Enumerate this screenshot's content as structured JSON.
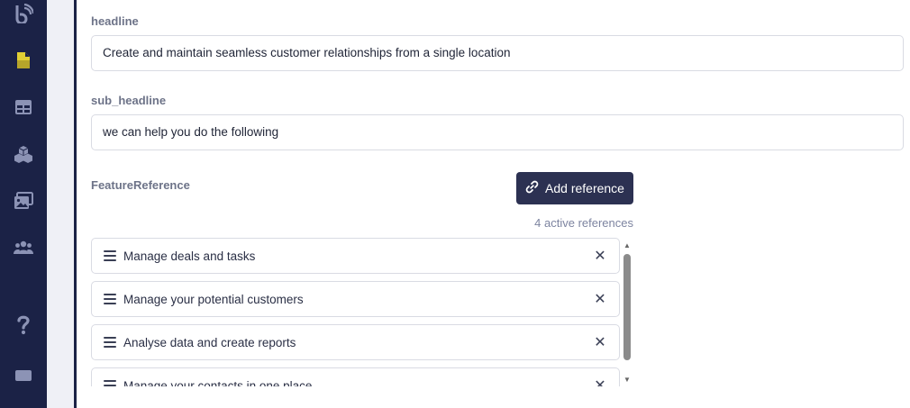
{
  "sidebar": {
    "icons": [
      "brand-logo-icon",
      "page-icon",
      "table-icon",
      "cubes-icon",
      "media-icon",
      "users-icon",
      "help-icon",
      "chat-icon"
    ],
    "active_color": "#e1cf34"
  },
  "fields": {
    "headline": {
      "label": "headline",
      "value": "Create and maintain seamless customer relationships from a single location"
    },
    "sub_headline": {
      "label": "sub_headline",
      "value": "we can help you do the following"
    },
    "feature_reference": {
      "label": "FeatureReference",
      "add_button": "Add reference",
      "count_text": "4 active references",
      "items": [
        {
          "label": "Manage deals and tasks"
        },
        {
          "label": "Manage your potential customers"
        },
        {
          "label": "Analyse data and create reports"
        },
        {
          "label": "Manage your contacts in one place"
        }
      ]
    }
  },
  "colors": {
    "sidebar_bg": "#1b2246",
    "button_bg": "#2c3152",
    "label_color": "#6d7388"
  }
}
